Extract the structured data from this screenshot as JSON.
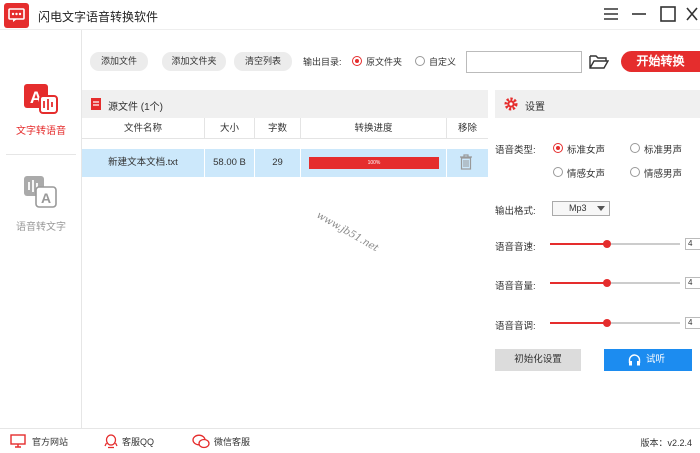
{
  "window": {
    "title": "闪电文字语音转换软件"
  },
  "sidebar": {
    "items": [
      {
        "label": "文字转语音",
        "active": true
      },
      {
        "label": "语音转文字",
        "active": false
      }
    ]
  },
  "toolbar": {
    "add_file": "添加文件",
    "add_folder": "添加文件夹",
    "clear_list": "清空列表",
    "output_dir_label": "输出目录:",
    "source_folder": "原文件夹",
    "custom": "自定义",
    "output_path": "",
    "start": "开始转换"
  },
  "files": {
    "header": "源文件 (1个)",
    "columns": [
      "文件名称",
      "大小",
      "字数",
      "转换进度",
      "移除"
    ],
    "rows": [
      {
        "name": "新建文本文档.txt",
        "size": "58.00 B",
        "words": "29",
        "progress": 100,
        "progress_text": "100%"
      }
    ]
  },
  "settings": {
    "header": "设置",
    "voice_type_label": "语音类型:",
    "voices": [
      "标准女声",
      "标准男声",
      "情感女声",
      "情感男声"
    ],
    "selected_voice": "标准女声",
    "format_label": "输出格式:",
    "format_value": "Mp3",
    "speed_label": "语音音速:",
    "speed_value": "4",
    "speed_level": 0.44,
    "volume_label": "语音音量:",
    "volume_value": "4",
    "volume_level": 0.44,
    "pitch_label": "语音音调:",
    "pitch_value": "4",
    "pitch_level": 0.44,
    "reset": "初始化设置",
    "listen": "试听"
  },
  "footer": {
    "website": "官方网站",
    "qq": "客服QQ",
    "wechat": "微信客服",
    "version": "版本：v2.2.4"
  },
  "watermark": "www.jb51.net",
  "colors": {
    "accent": "#e52d2d",
    "blue": "#1c8cf0",
    "row_selected": "#cce8fb"
  }
}
